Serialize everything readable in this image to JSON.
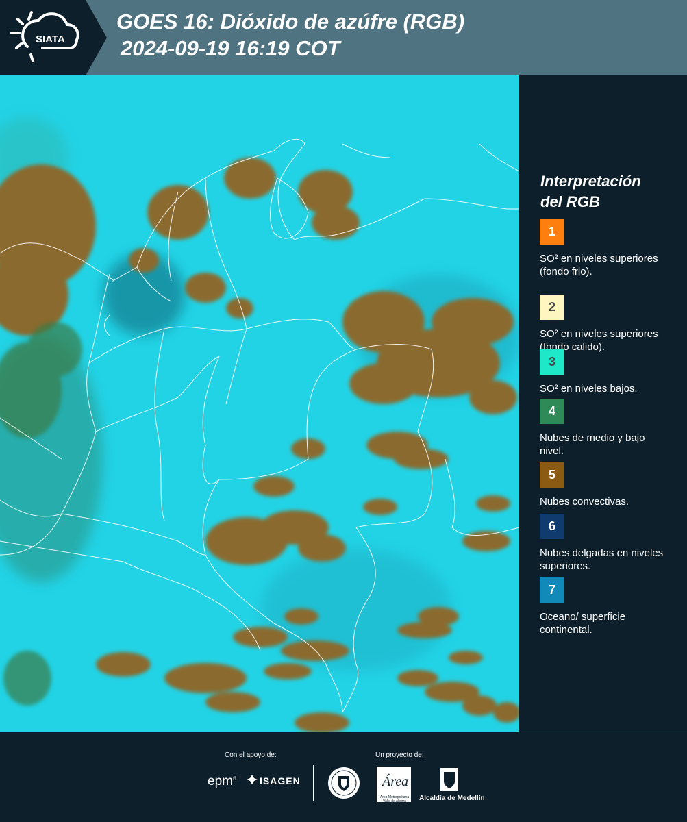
{
  "header": {
    "logo_text": "SIATA",
    "title_line1": "GOES 16: Dióxido de azúfre (RGB)",
    "title_line2": "2024-09-19 16:19 COT"
  },
  "map": {
    "background_color": "#22d3e6",
    "cloud_color": "#8a6a2f",
    "border_color": "#ffffff"
  },
  "legend": {
    "title_line1": "Interpretación",
    "title_line2": "del RGB",
    "items": [
      {
        "number": "1",
        "color": "#ff7f0e",
        "label": "SO² en niveles superiores (fondo frio)."
      },
      {
        "number": "2",
        "color": "#fdf6c0",
        "label": "SO² en niveles superiores (fondo calido)."
      },
      {
        "number": "3",
        "color": "#1fe8c9",
        "label": "SO² en niveles bajos."
      },
      {
        "number": "4",
        "color": "#2e8b57",
        "label": "Nubes de medio y bajo nivel."
      },
      {
        "number": "5",
        "color": "#8b5a13",
        "label": "Nubes convectivas."
      },
      {
        "number": "6",
        "color": "#0f3b6e",
        "label": "Nubes delgadas en niveles superiores."
      },
      {
        "number": "7",
        "color": "#118ab8",
        "label": "Oceano/ superficie continental."
      }
    ]
  },
  "footer": {
    "support_label": "Con el apoyo de:",
    "project_label": "Un proyecto de:",
    "sponsor_1": "epm",
    "sponsor_2": "ISAGEN",
    "partner_1": "Área Metropolitana Valle de Aburrá",
    "partner_2": "Alcaldía de Medellín"
  }
}
